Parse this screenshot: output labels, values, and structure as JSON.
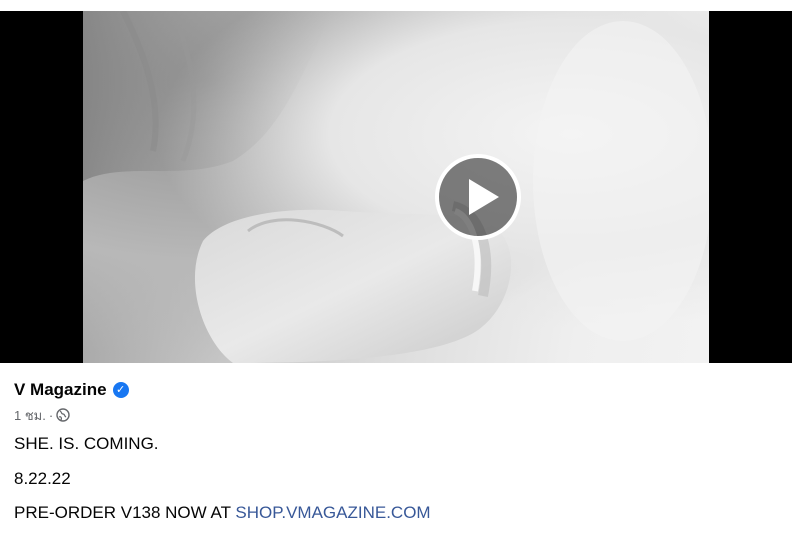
{
  "post": {
    "author_name": "V Magazine",
    "verified_icon": "verified-badge-icon",
    "timestamp": "1 ชม.",
    "separator": "·",
    "privacy_icon": "globe-icon",
    "video": {
      "play_icon": "play-icon"
    },
    "text": {
      "line1": "SHE. IS. COMING.",
      "line2": "8.22.22",
      "line3_prefix": "PRE-ORDER V138 NOW AT ",
      "link_text": "SHOP.VMAGAZINE.COM"
    }
  },
  "colors": {
    "link": "#385898",
    "verified": "#1877f2",
    "text": "#050505",
    "meta": "#65676b"
  }
}
